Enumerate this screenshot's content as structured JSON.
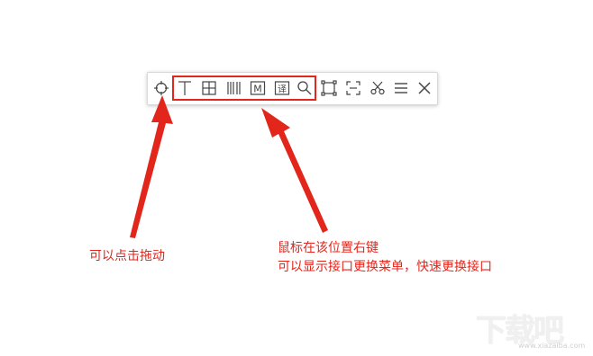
{
  "toolbar": {
    "tools": [
      {
        "icon": "drag-handle-icon"
      },
      {
        "icon": "text-ocr-icon"
      },
      {
        "icon": "table-ocr-icon"
      },
      {
        "icon": "barcode-icon"
      },
      {
        "icon": "formula-m-icon",
        "glyph": "M"
      },
      {
        "icon": "translate-icon",
        "glyph": "译"
      },
      {
        "icon": "search-icon"
      },
      {
        "icon": "region-select-icon"
      },
      {
        "icon": "fullscreen-capture-icon"
      },
      {
        "icon": "scissors-icon"
      },
      {
        "icon": "menu-icon"
      },
      {
        "icon": "close-icon"
      }
    ],
    "highlight_color": "#e2261c"
  },
  "annotations": {
    "drag": "可以点击拖动",
    "switch_line1": "鼠标在该位置右键",
    "switch_line2": "可以显示接口更换菜单，快速更换接口"
  },
  "watermark": {
    "text": "下载吧",
    "url": "www.xiazaiba.com"
  }
}
